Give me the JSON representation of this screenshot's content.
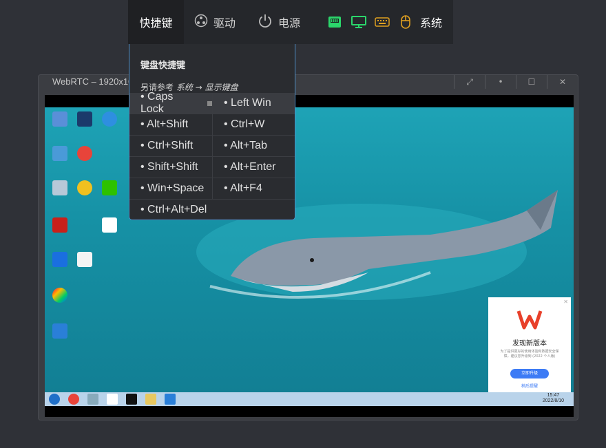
{
  "toolbar": {
    "shortcuts_label": "快捷键",
    "drive_label": "驱动",
    "power_label": "电源",
    "system_label": "系统",
    "status_icons": [
      "network-icon",
      "monitor-icon",
      "keyboard-icon",
      "mouse-icon"
    ],
    "colors": {
      "network": "#2bd66b",
      "monitor": "#2bd66b",
      "keyboard": "#e0a020",
      "mouse": "#e0a020"
    }
  },
  "dropdown": {
    "title": "键盘快捷键",
    "hint_prefix": "另请参考 ",
    "hint_path": "系统 → 显示键盘",
    "rows": [
      {
        "left": "• Caps Lock",
        "right": "• Left Win"
      },
      {
        "left": "• Alt+Shift",
        "right": "• Ctrl+W"
      },
      {
        "left": "• Ctrl+Shift",
        "right": "• Alt+Tab"
      },
      {
        "left": "• Shift+Shift",
        "right": "• Alt+Enter"
      },
      {
        "left": "• Win+Space",
        "right": "• Alt+F4"
      }
    ],
    "full_row": "• Ctrl+Alt+Del"
  },
  "window": {
    "title": "WebRTC – 1920x10",
    "buttons": [
      "expand-icon",
      "dot-icon",
      "maximize-icon",
      "close-icon"
    ]
  },
  "remote_desktop": {
    "taskbar_time": "15:47",
    "taskbar_date": "2022/8/10",
    "wps_popup": {
      "title": "发现新版本",
      "description": "为了提供更好的使用体验和数据安全保障，建议您升级到 (2022 个人版)",
      "update_button": "立即升级",
      "later_link": "稍后提醒"
    }
  }
}
